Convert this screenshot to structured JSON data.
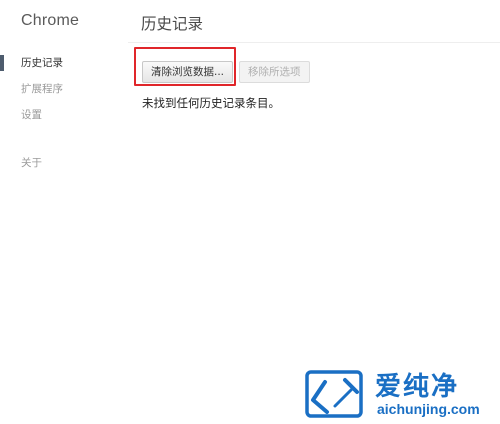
{
  "sidebar": {
    "brand": "Chrome",
    "items": [
      {
        "label": "历史记录",
        "active": true
      },
      {
        "label": "扩展程序",
        "active": false
      },
      {
        "label": "设置",
        "active": false
      },
      {
        "label": "关于",
        "active": false
      }
    ]
  },
  "main": {
    "title": "历史记录",
    "clear_button": "清除浏览数据...",
    "remove_button": "移除所选项",
    "empty_message": "未找到任何历史记录条目。"
  },
  "watermark": {
    "logo_icon": "aichunjing-logo",
    "text": "爱纯净",
    "url": "aichunjing.com"
  },
  "colors": {
    "highlight": "#e0262a",
    "active_indicator": "#4e5c6e",
    "watermark": "#1a6fc4"
  }
}
